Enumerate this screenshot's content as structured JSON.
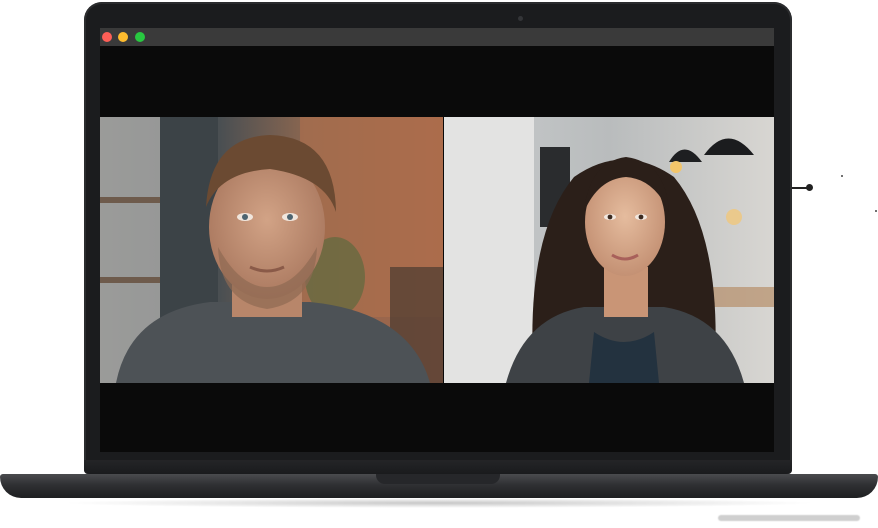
{
  "window": {
    "controls": [
      "close",
      "minimize",
      "maximize"
    ]
  },
  "video_call": {
    "participants": [
      {
        "id": "participant-man"
      },
      {
        "id": "participant-woman"
      }
    ]
  },
  "colors": {
    "bezel": "#1b1c1e",
    "screen": "#0a0a0a",
    "titlebar": "#3a3a3a",
    "close": "#fe5f57",
    "minimize": "#febc2e",
    "maximize": "#28c840"
  }
}
